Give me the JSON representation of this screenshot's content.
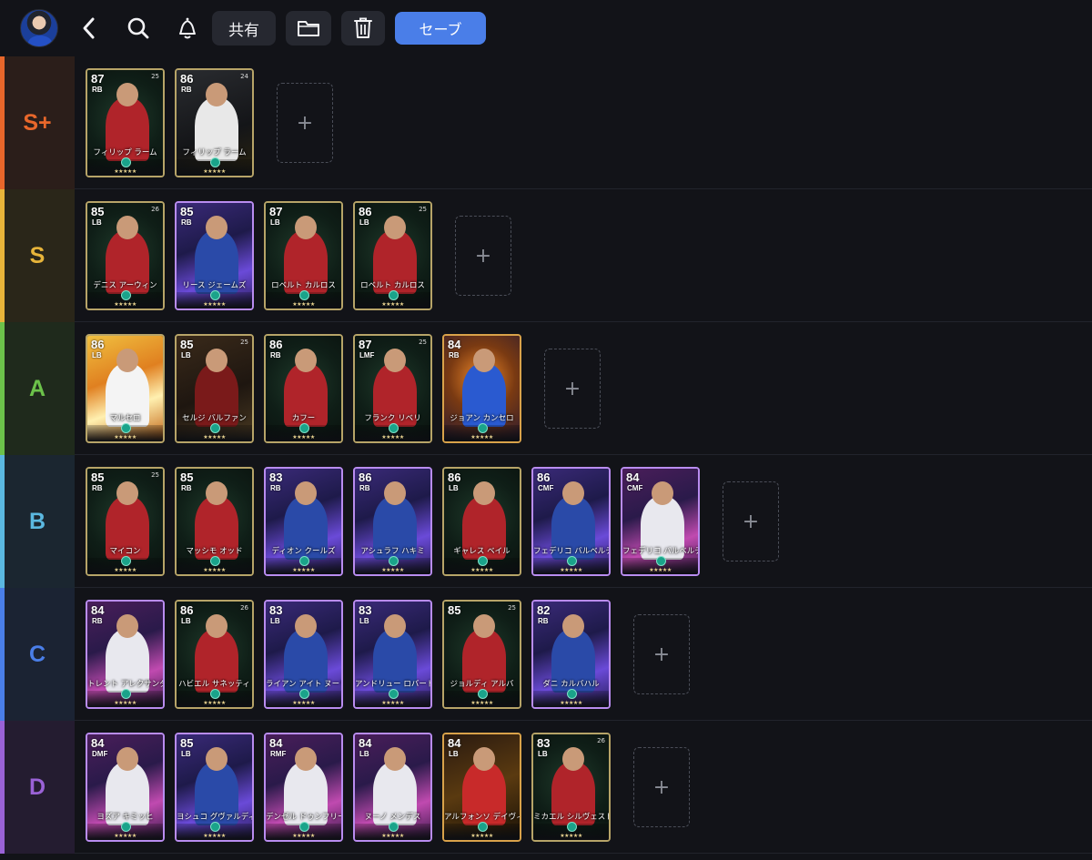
{
  "toolbar": {
    "share_label": "共有",
    "save_label": "セーブ"
  },
  "add_symbol": "+",
  "tiers": [
    {
      "label": "S+",
      "color": "#e8672b",
      "bg": "#2b1e1a",
      "cards": [
        {
          "rating": "87",
          "position": "RB",
          "version": "25",
          "name": "フィリップ ラーム",
          "style": "green"
        },
        {
          "rating": "86",
          "position": "RB",
          "version": "24",
          "name": "フィリップ ラーム",
          "style": "dark"
        }
      ]
    },
    {
      "label": "S",
      "color": "#e7b43a",
      "bg": "#2a2619",
      "cards": [
        {
          "rating": "85",
          "position": "LB",
          "version": "26",
          "name": "デニス アーウィン",
          "style": "green"
        },
        {
          "rating": "85",
          "position": "RB",
          "version": "",
          "name": "リース ジェームズ",
          "style": "epic"
        },
        {
          "rating": "87",
          "position": "LB",
          "version": "",
          "name": "ロベルト カルロス",
          "style": "green"
        },
        {
          "rating": "86",
          "position": "LB",
          "version": "25",
          "name": "ロベルト カルロス",
          "style": "green"
        }
      ]
    },
    {
      "label": "A",
      "color": "#6cc24a",
      "bg": "#1f2a1c",
      "cards": [
        {
          "rating": "86",
          "position": "LB",
          "version": "",
          "name": "マルセロ",
          "style": "fire"
        },
        {
          "rating": "85",
          "position": "LB",
          "version": "25",
          "name": "セルジ バルファン",
          "style": "brown"
        },
        {
          "rating": "86",
          "position": "RB",
          "version": "",
          "name": "カフー",
          "style": "green"
        },
        {
          "rating": "87",
          "position": "LMF",
          "version": "25",
          "name": "フランク リベリ",
          "style": "green"
        },
        {
          "rating": "84",
          "position": "RB",
          "version": "",
          "name": "ジョアン カンセロ",
          "style": "orange"
        }
      ]
    },
    {
      "label": "B",
      "color": "#5bb8e0",
      "bg": "#1b2630",
      "cards": [
        {
          "rating": "85",
          "position": "RB",
          "version": "25",
          "name": "マイコン",
          "style": "green"
        },
        {
          "rating": "85",
          "position": "RB",
          "version": "",
          "name": "マッシモ オッド",
          "style": "green"
        },
        {
          "rating": "83",
          "position": "RB",
          "version": "",
          "name": "ディオン クールズ",
          "style": "epic"
        },
        {
          "rating": "86",
          "position": "RB",
          "version": "",
          "name": "アシュラフ ハキミ",
          "style": "epic"
        },
        {
          "rating": "86",
          "position": "LB",
          "version": "",
          "name": "ギャレス ベイル",
          "style": "green"
        },
        {
          "rating": "86",
          "position": "CMF",
          "version": "",
          "name": "フェデリコ バルベルデ",
          "style": "epic"
        },
        {
          "rating": "84",
          "position": "CMF",
          "version": "",
          "name": "フェデリコ バルベルデ",
          "style": "pink"
        }
      ]
    },
    {
      "label": "C",
      "color": "#4a7ee8",
      "bg": "#1b2333",
      "cards": [
        {
          "rating": "84",
          "position": "RB",
          "version": "",
          "name": "トレント アレクサンダー",
          "style": "pink"
        },
        {
          "rating": "86",
          "position": "LB",
          "version": "26",
          "name": "ハビエル サネッティ",
          "style": "green"
        },
        {
          "rating": "83",
          "position": "LB",
          "version": "",
          "name": "ライアン アイト ヌーリ",
          "style": "epic"
        },
        {
          "rating": "83",
          "position": "LB",
          "version": "",
          "name": "アンドリュー ロバートソン",
          "style": "epic"
        },
        {
          "rating": "85",
          "position": "",
          "version": "25",
          "name": "ジョルディ アルバ",
          "style": "green"
        },
        {
          "rating": "82",
          "position": "RB",
          "version": "",
          "name": "ダニ カルバハル",
          "style": "epic"
        }
      ]
    },
    {
      "label": "D",
      "color": "#9a62d6",
      "bg": "#241c30",
      "cards": [
        {
          "rating": "84",
          "position": "DMF",
          "version": "",
          "name": "ヨズア キミッヒ",
          "style": "pink"
        },
        {
          "rating": "85",
          "position": "LB",
          "version": "",
          "name": "ヨシュコ グヴァルディオル",
          "style": "epic"
        },
        {
          "rating": "84",
          "position": "RMF",
          "version": "",
          "name": "デンゼル ドゥンフリース",
          "style": "pink"
        },
        {
          "rating": "84",
          "position": "LB",
          "version": "",
          "name": "ヌーノ メンデス",
          "style": "pink"
        },
        {
          "rating": "84",
          "position": "LB",
          "version": "",
          "name": "アルフォンソ デイヴィス",
          "style": "gold"
        },
        {
          "rating": "83",
          "position": "LB",
          "version": "26",
          "name": "ミカエル シルヴェストル",
          "style": "green"
        }
      ]
    }
  ]
}
